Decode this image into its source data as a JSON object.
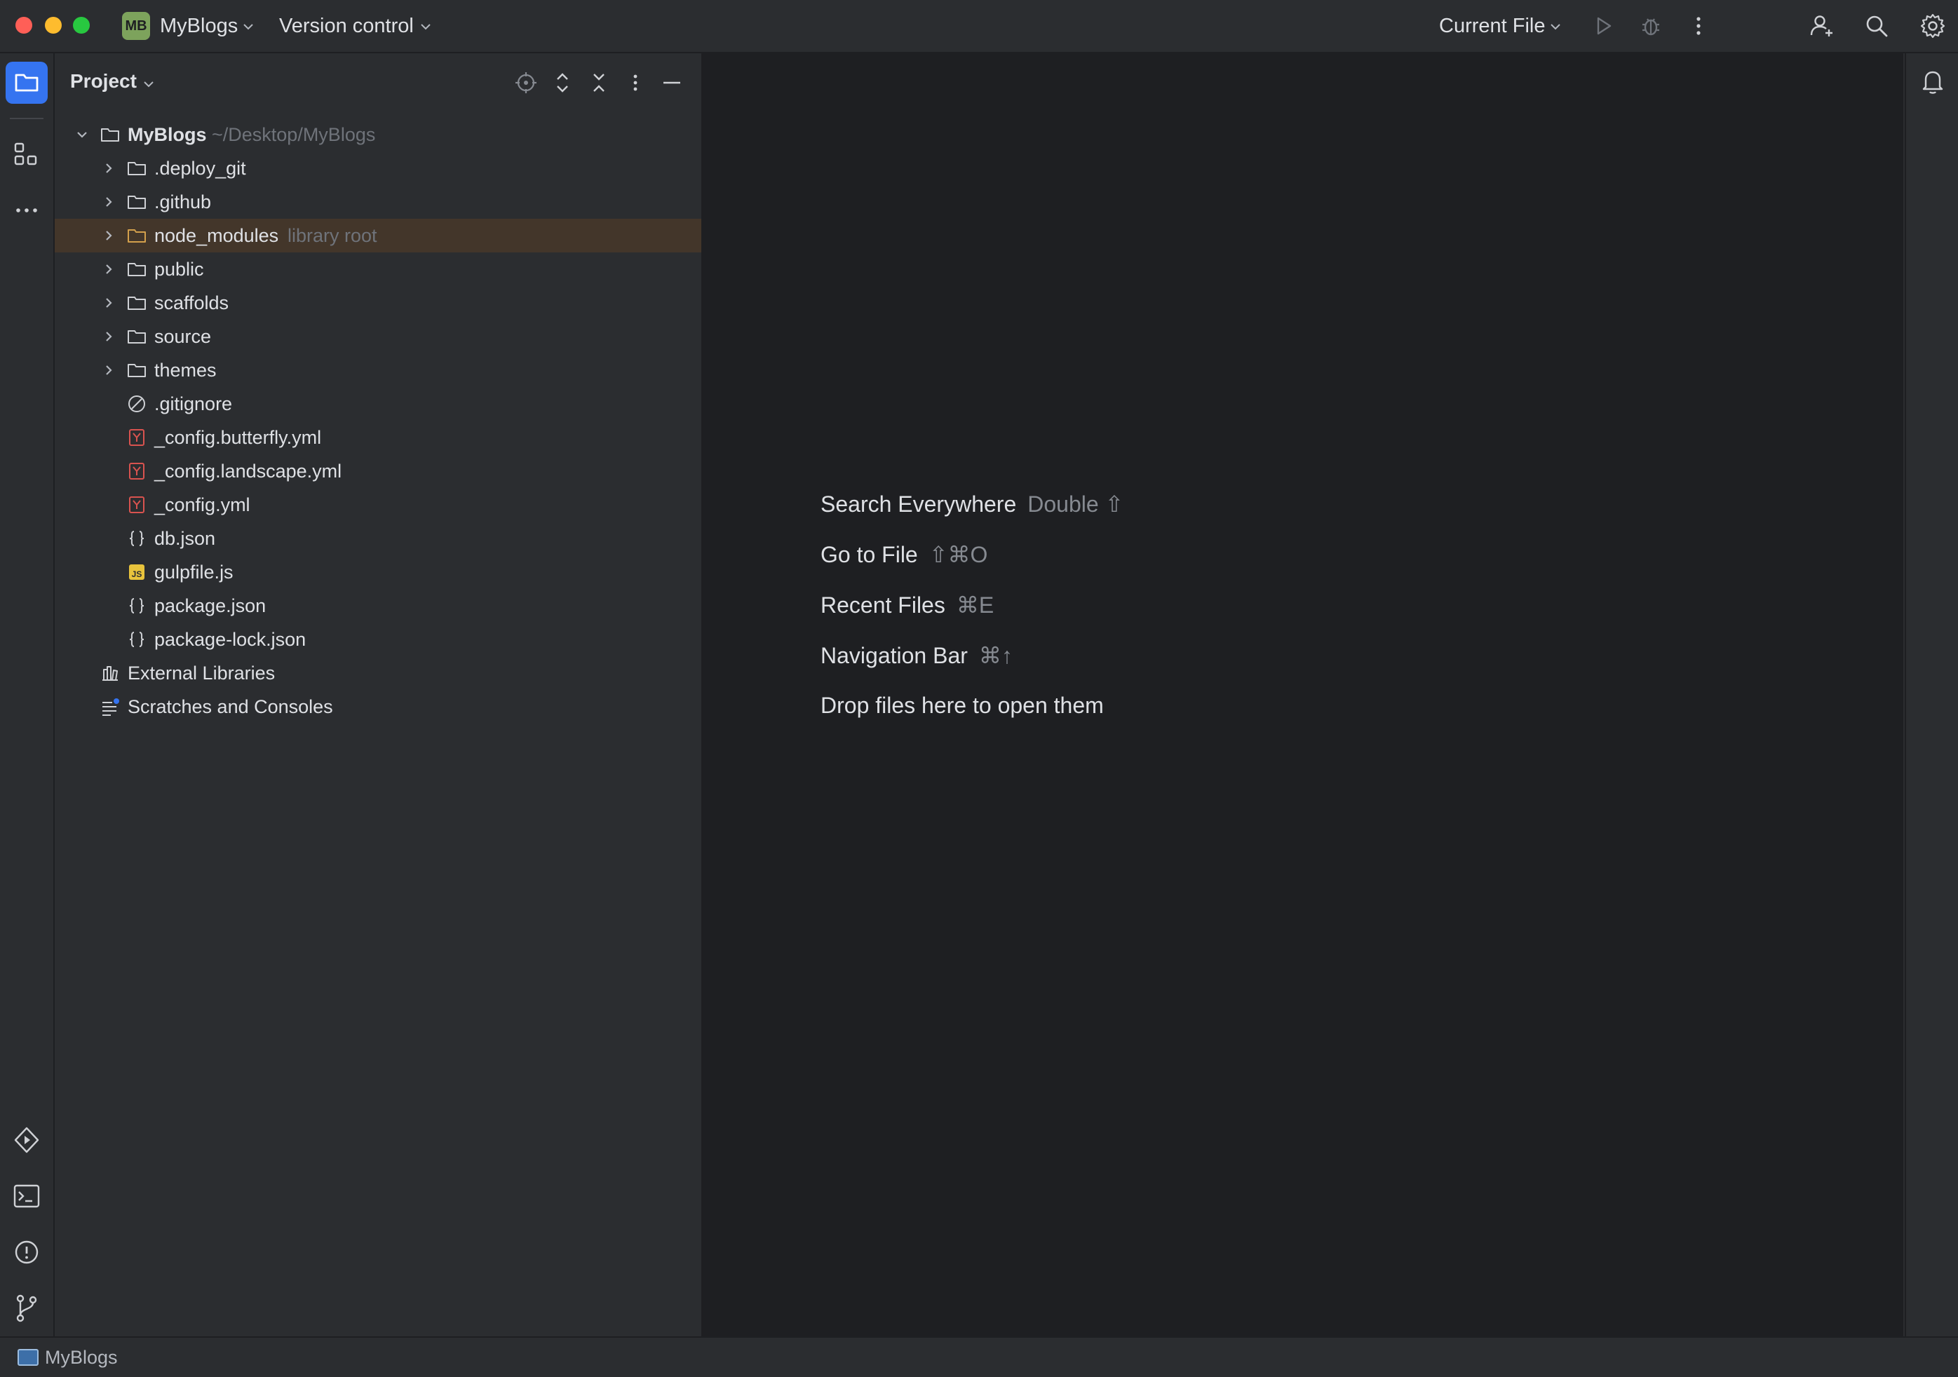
{
  "titlebar": {
    "project_badge": "MB",
    "project_name": "MyBlogs",
    "vcs_label": "Version control",
    "run_config": "Current File",
    "icons": [
      "run-icon",
      "debug-icon",
      "more-icon",
      "add-user-icon",
      "search-icon",
      "settings-icon"
    ]
  },
  "project_panel": {
    "title": "Project",
    "root": {
      "name": "MyBlogs",
      "path": "~/Desktop/MyBlogs"
    },
    "folders": [
      {
        "name": ".deploy_git",
        "hint": ""
      },
      {
        "name": ".github",
        "hint": ""
      },
      {
        "name": "node_modules",
        "hint": "library root"
      },
      {
        "name": "public",
        "hint": ""
      },
      {
        "name": "scaffolds",
        "hint": ""
      },
      {
        "name": "source",
        "hint": ""
      },
      {
        "name": "themes",
        "hint": ""
      }
    ],
    "files": [
      {
        "name": ".gitignore",
        "icon": "ignore-file-icon"
      },
      {
        "name": "_config.butterfly.yml",
        "icon": "yaml-file-icon"
      },
      {
        "name": "_config.landscape.yml",
        "icon": "yaml-file-icon"
      },
      {
        "name": "_config.yml",
        "icon": "yaml-file-icon"
      },
      {
        "name": "db.json",
        "icon": "json-file-icon"
      },
      {
        "name": "gulpfile.js",
        "icon": "js-file-icon"
      },
      {
        "name": "package.json",
        "icon": "json-file-icon"
      },
      {
        "name": "package-lock.json",
        "icon": "json-file-icon"
      }
    ],
    "external_libraries": "External Libraries",
    "scratches": "Scratches and Consoles"
  },
  "editor_empty": {
    "search_everywhere": {
      "label": "Search Everywhere",
      "shortcut": "Double ⇧"
    },
    "go_to_file": {
      "label": "Go to File",
      "shortcut": "⇧⌘O"
    },
    "recent_files": {
      "label": "Recent Files",
      "shortcut": "⌘E"
    },
    "navigation_bar": {
      "label": "Navigation Bar",
      "shortcut": "⌘↑"
    },
    "drop_files": "Drop files here to open them"
  },
  "statusbar": {
    "project": "MyBlogs"
  },
  "colors": {
    "accent": "#3574f0",
    "selection": "#43362a",
    "panel_bg": "#2b2d30",
    "editor_bg": "#1e1f22",
    "yaml_icon": "#d9534f",
    "js_icon": "#e8c33c"
  }
}
